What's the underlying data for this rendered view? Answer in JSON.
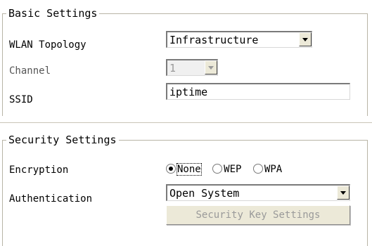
{
  "basic": {
    "title": "Basic Settings",
    "topology_label": "WLAN Topology",
    "topology_value": "Infrastructure",
    "channel_label": "Channel",
    "channel_value": "1",
    "ssid_label": "SSID",
    "ssid_value": "iptime"
  },
  "security": {
    "title": "Security Settings",
    "encryption_label": "Encryption",
    "encryption_options": [
      "None",
      "WEP",
      "WPA"
    ],
    "encryption_selected": "None",
    "auth_label": "Authentication",
    "auth_value": "Open System",
    "key_button": "Security Key Settings"
  }
}
